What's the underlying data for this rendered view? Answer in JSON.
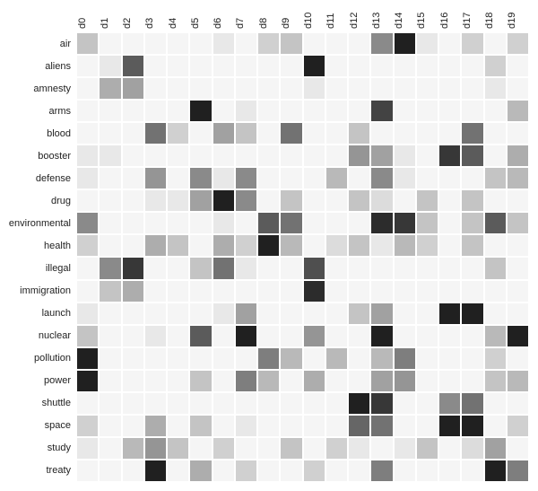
{
  "chart_data": {
    "type": "heatmap",
    "title": "",
    "xlabel": "",
    "ylabel": "",
    "x_categories": [
      "d0",
      "d1",
      "d2",
      "d3",
      "d4",
      "d5",
      "d6",
      "d7",
      "d8",
      "d9",
      "d10",
      "d11",
      "d12",
      "d13",
      "d14",
      "d15",
      "d16",
      "d17",
      "d18",
      "d19"
    ],
    "y_categories": [
      "air",
      "aliens",
      "amnesty",
      "arms",
      "blood",
      "booster",
      "defense",
      "drug",
      "environmental",
      "health",
      "illegal",
      "immigration",
      "launch",
      "nuclear",
      "pollution",
      "power",
      "shuttle",
      "space",
      "study",
      "treaty"
    ],
    "value_scale": {
      "min": 0,
      "max": 1,
      "note": "0 = white/off, 1 = black/darkest"
    },
    "values": [
      [
        0.25,
        0.05,
        0.05,
        0.05,
        0.05,
        0.05,
        0.1,
        0.05,
        0.2,
        0.25,
        0.05,
        0.05,
        0.05,
        0.5,
        0.95,
        0.1,
        0.05,
        0.2,
        0.05,
        0.2
      ],
      [
        0.05,
        0.1,
        0.7,
        0.05,
        0.05,
        0.05,
        0.05,
        0.05,
        0.05,
        0.05,
        0.95,
        0.05,
        0.05,
        0.05,
        0.05,
        0.05,
        0.05,
        0.05,
        0.2,
        0.05
      ],
      [
        0.05,
        0.35,
        0.4,
        0.05,
        0.05,
        0.05,
        0.05,
        0.05,
        0.05,
        0.05,
        0.1,
        0.05,
        0.05,
        0.05,
        0.05,
        0.05,
        0.05,
        0.05,
        0.1,
        0.05
      ],
      [
        0.05,
        0.05,
        0.05,
        0.05,
        0.05,
        0.95,
        0.05,
        0.1,
        0.05,
        0.05,
        0.05,
        0.05,
        0.05,
        0.8,
        0.05,
        0.05,
        0.05,
        0.05,
        0.05,
        0.3
      ],
      [
        0.05,
        0.05,
        0.05,
        0.6,
        0.2,
        0.05,
        0.4,
        0.25,
        0.05,
        0.6,
        0.05,
        0.05,
        0.25,
        0.05,
        0.05,
        0.05,
        0.05,
        0.6,
        0.05,
        0.05
      ],
      [
        0.1,
        0.1,
        0.05,
        0.05,
        0.05,
        0.05,
        0.05,
        0.05,
        0.05,
        0.05,
        0.05,
        0.05,
        0.45,
        0.4,
        0.1,
        0.05,
        0.85,
        0.7,
        0.05,
        0.35
      ],
      [
        0.1,
        0.05,
        0.05,
        0.45,
        0.05,
        0.5,
        0.1,
        0.5,
        0.05,
        0.05,
        0.05,
        0.3,
        0.05,
        0.5,
        0.1,
        0.05,
        0.05,
        0.05,
        0.25,
        0.3
      ],
      [
        0.05,
        0.05,
        0.05,
        0.1,
        0.1,
        0.4,
        0.95,
        0.5,
        0.05,
        0.25,
        0.05,
        0.05,
        0.25,
        0.15,
        0.05,
        0.25,
        0.05,
        0.25,
        0.05,
        0.05
      ],
      [
        0.5,
        0.05,
        0.05,
        0.05,
        0.05,
        0.05,
        0.1,
        0.05,
        0.7,
        0.6,
        0.05,
        0.05,
        0.05,
        0.9,
        0.85,
        0.25,
        0.05,
        0.25,
        0.7,
        0.25
      ],
      [
        0.2,
        0.05,
        0.05,
        0.35,
        0.25,
        0.05,
        0.35,
        0.2,
        0.95,
        0.3,
        0.05,
        0.15,
        0.25,
        0.1,
        0.3,
        0.2,
        0.05,
        0.25,
        0.05,
        0.05
      ],
      [
        0.05,
        0.5,
        0.85,
        0.05,
        0.05,
        0.25,
        0.6,
        0.1,
        0.05,
        0.05,
        0.75,
        0.05,
        0.05,
        0.05,
        0.05,
        0.05,
        0.05,
        0.05,
        0.25,
        0.05
      ],
      [
        0.05,
        0.25,
        0.35,
        0.05,
        0.05,
        0.05,
        0.05,
        0.05,
        0.05,
        0.05,
        0.9,
        0.05,
        0.05,
        0.05,
        0.05,
        0.05,
        0.05,
        0.05,
        0.05,
        0.05
      ],
      [
        0.1,
        0.05,
        0.05,
        0.05,
        0.05,
        0.05,
        0.1,
        0.4,
        0.05,
        0.05,
        0.05,
        0.05,
        0.25,
        0.4,
        0.05,
        0.05,
        0.95,
        0.95,
        0.05,
        0.05
      ],
      [
        0.25,
        0.05,
        0.05,
        0.1,
        0.05,
        0.7,
        0.05,
        0.95,
        0.05,
        0.05,
        0.45,
        0.05,
        0.05,
        0.95,
        0.05,
        0.05,
        0.05,
        0.05,
        0.3,
        0.95
      ],
      [
        0.95,
        0.05,
        0.05,
        0.05,
        0.05,
        0.05,
        0.05,
        0.05,
        0.55,
        0.3,
        0.05,
        0.3,
        0.05,
        0.3,
        0.55,
        0.05,
        0.05,
        0.05,
        0.2,
        0.05
      ],
      [
        0.95,
        0.05,
        0.05,
        0.05,
        0.05,
        0.25,
        0.05,
        0.55,
        0.3,
        0.05,
        0.35,
        0.05,
        0.05,
        0.4,
        0.45,
        0.05,
        0.05,
        0.05,
        0.25,
        0.3
      ],
      [
        0.05,
        0.05,
        0.05,
        0.05,
        0.05,
        0.05,
        0.05,
        0.05,
        0.05,
        0.05,
        0.05,
        0.05,
        0.95,
        0.85,
        0.05,
        0.05,
        0.5,
        0.6,
        0.05,
        0.05
      ],
      [
        0.2,
        0.05,
        0.05,
        0.35,
        0.05,
        0.25,
        0.05,
        0.1,
        0.05,
        0.05,
        0.05,
        0.05,
        0.65,
        0.6,
        0.05,
        0.05,
        0.95,
        0.95,
        0.05,
        0.2
      ],
      [
        0.1,
        0.05,
        0.3,
        0.45,
        0.25,
        0.05,
        0.2,
        0.05,
        0.05,
        0.25,
        0.05,
        0.2,
        0.1,
        0.05,
        0.1,
        0.25,
        0.05,
        0.15,
        0.4,
        0.05
      ],
      [
        0.05,
        0.05,
        0.05,
        0.95,
        0.05,
        0.35,
        0.05,
        0.2,
        0.05,
        0.05,
        0.2,
        0.05,
        0.05,
        0.55,
        0.05,
        0.05,
        0.05,
        0.05,
        0.95,
        0.55
      ]
    ]
  }
}
